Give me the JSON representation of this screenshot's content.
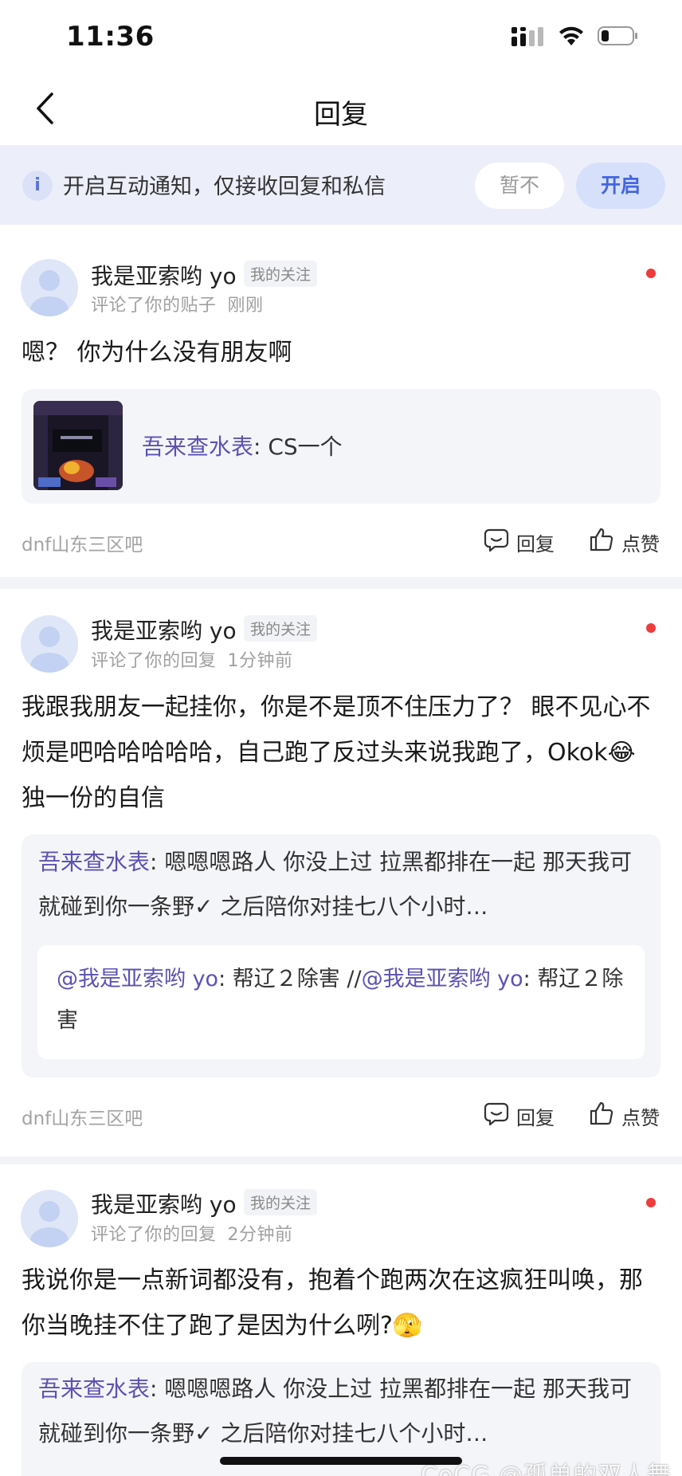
{
  "status_bar": {
    "time": "11:36"
  },
  "nav": {
    "title": "回复"
  },
  "notice": {
    "icon": "info-icon",
    "icon_glyph": "i",
    "text": "开启互动通知，仅接收回复和私信",
    "later_label": "暂不",
    "enable_label": "开启"
  },
  "colors": {
    "accent": "#4266df",
    "link": "#5b52b4",
    "unread": "#f03b3b"
  },
  "notifications": [
    {
      "user": "我是亚索哟 yo",
      "follow_tag": "我的关注",
      "action": "评论了你的贴子",
      "time": "刚刚",
      "body": "嗯？ 你为什么没有朋友啊",
      "quote": {
        "author": "吾来查水表",
        "text": ": CS一个"
      },
      "forum": "dnf山东三区吧",
      "reply_label": "回复",
      "like_label": "点赞"
    },
    {
      "user": "我是亚索哟 yo",
      "follow_tag": "我的关注",
      "action": "评论了你的回复",
      "time": "1分钟前",
      "body": "我跟我朋友一起挂你，你是不是顶不住压力了？ 眼不见心不烦是吧哈哈哈哈哈，自己跑了反过头来说我跑了，Okok😂 独一份的自信",
      "quote": {
        "author": "吾来查水表",
        "text": ": 嗯嗯嗯路人 你没上过 拉黑都排在一起 那天我可就碰到你一条野✓ 之后陪你对挂七八个小时…",
        "nested_mention_1": "@我是亚索哟 yo",
        "nested_text_1": ": 帮辽２除害 //",
        "nested_mention_2": "@我是亚索哟 yo",
        "nested_text_2": ": 帮辽２除害"
      },
      "forum": "dnf山东三区吧",
      "reply_label": "回复",
      "like_label": "点赞"
    },
    {
      "user": "我是亚索哟 yo",
      "follow_tag": "我的关注",
      "action": "评论了你的回复",
      "time": "2分钟前",
      "body": "我说你是一点新词都没有，抱着个跑两次在这疯狂叫唤，那你当晚挂不住了跑了是因为什么咧?🫣",
      "quote": {
        "author": "吾来查水表",
        "text": ": 嗯嗯嗯路人 你没上过 拉黑都排在一起 那天我可就碰到你一条野✓ 之后陪你对挂七八个小时…"
      }
    }
  ],
  "watermark": "CoCG @孤单的双人舞"
}
